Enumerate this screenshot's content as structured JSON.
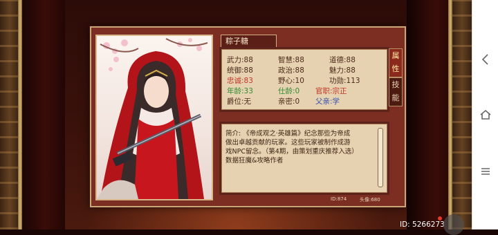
{
  "character": {
    "name": "粽子糖"
  },
  "stats": {
    "wuli": "武力:88",
    "zhihui": "智慧:88",
    "daode": "道德:88",
    "tongyu": "统御:88",
    "zhengzhi": "政治:88",
    "meili": "魅力:88",
    "zhongcheng": "忠诚:83",
    "yexin": "野心:10",
    "gongxun": "功勋:113",
    "nianling": "年龄:33",
    "shiling": "仕龄:0",
    "guanzhi": "官职:宗正",
    "juewei": "爵位:无",
    "qinmi": "亲密:0",
    "fuqin": "父亲:学"
  },
  "description": "简介: 《帝成观之·英雄篇》纪念那些为帝成做出卓越贡献的玩家。这些玩家被制作成游戏NPC留念。（第4期，由策划重庆推荐入选）数据狂魔&攻略作者",
  "tabs": {
    "attributes": "属性",
    "skills": "技能"
  },
  "footer": {
    "id": "ID:874",
    "avatar": "头像:680"
  },
  "screen": {
    "player_id": "ID: 5266273"
  },
  "colors": {
    "panel": "#7d2e23",
    "parchment": "#e6d2b0",
    "red_stat": "#c0372a",
    "green_stat": "#2f8a35",
    "blue_stat": "#3550b0"
  },
  "icons": [
    "back-icon",
    "home-icon",
    "menu-icon"
  ]
}
